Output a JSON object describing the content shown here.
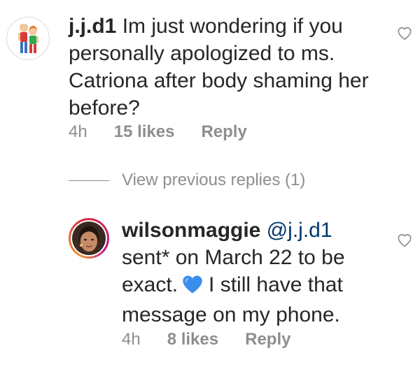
{
  "parent_comment": {
    "avatar_icon": "cartoon-family-avatar",
    "username": "j.j.d1",
    "text": "Im just wondering if you personally apologized to ms. Catriona after body shaming her before?",
    "time": "4h",
    "likes": "15 likes",
    "reply_label": "Reply",
    "like_icon": "heart-outline-icon"
  },
  "view_previous_replies": {
    "label": "View previous replies (1)"
  },
  "reply_comment": {
    "avatar_icon": "profile-photo-avatar",
    "username": "wilsonmaggie",
    "mention": "@j.j.d1",
    "text_before_emoji": "sent* on March 22 to be exact.",
    "emoji": "blue-heart",
    "text_after_emoji": "I still have that message on my phone.",
    "time": "4h",
    "likes": "8 likes",
    "reply_label": "Reply",
    "like_icon": "heart-outline-icon"
  },
  "colors": {
    "text_primary": "#262626",
    "text_secondary": "#8e8e8e",
    "mention": "#00376b",
    "emoji_blue_heart": "#3b8ded"
  }
}
